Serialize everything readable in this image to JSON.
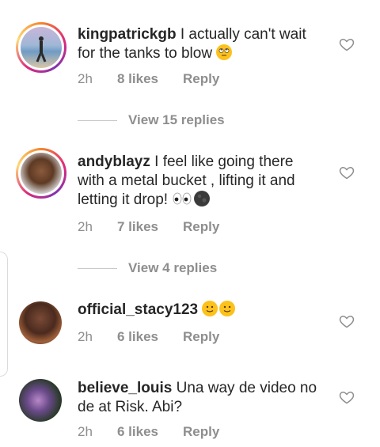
{
  "comments": [
    {
      "username": "kingpatrickgb",
      "text": " I actually can't wait for the tanks to blow ",
      "time": "2h",
      "likes": "8 likes",
      "reply": "Reply",
      "emoji": [
        "face-with-rolling-eyes"
      ]
    },
    {
      "username": "andyblayz",
      "text": " I feel like going there with a metal bucket , lifting it and letting it drop! ",
      "time": "2h",
      "likes": "7 likes",
      "reply": "Reply",
      "emoji": [
        "eyes",
        "new-moon-face"
      ]
    },
    {
      "username": "official_stacy123",
      "text": " ",
      "time": "2h",
      "likes": "6 likes",
      "reply": "Reply",
      "emoji": [
        "slightly-smiling-face",
        "slightly-smiling-face"
      ]
    },
    {
      "username": "believe_louis",
      "text": " Una way de video no de at Risk. Abi?",
      "time": "2h",
      "likes": "6 likes",
      "reply": "Reply",
      "emoji": []
    }
  ],
  "view_replies": [
    "View 15 replies",
    "View 4 replies"
  ],
  "colors": {
    "text": "#262626",
    "muted": "#8e8e8e",
    "divider": "#c7c7c7"
  }
}
